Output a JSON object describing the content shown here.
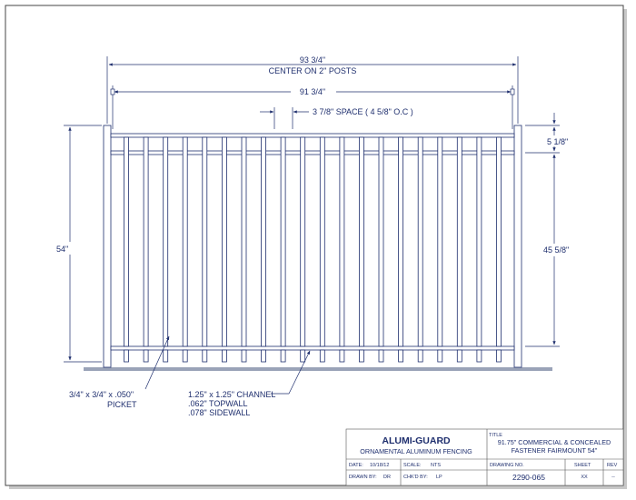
{
  "dimensions": {
    "overall_width": "93 3/4\"",
    "overall_note": "CENTER ON 2\" POSTS",
    "inner_width": "91 3/4\"",
    "picket_space": "3 7/8\" SPACE ( 4 5/8\" O.C )",
    "overall_height": "54\"",
    "top_rail_height": "5 1/8\"",
    "picket_height": "45 5/8\""
  },
  "callouts": {
    "picket_line1": "3/4\" x 3/4\" x  .050\"",
    "picket_line2": "PICKET",
    "channel_line1": "1.25\" x 1.25\" CHANNEL",
    "channel_line2": ".062\" TOPWALL",
    "channel_line3": ".078\" SIDEWALL"
  },
  "title_block": {
    "company": "ALUMI-GUARD",
    "subtitle": "ORNAMENTAL ALUMINUM FENCING",
    "title_label": "TITLE",
    "title_line1": "91.75\" COMMERCIAL & CONCEALED",
    "title_line2": "FASTENER FAIRMOUNT 54\"",
    "date_label": "DATE:",
    "date_value": "10/18/12",
    "scale_label": "SCALE:",
    "scale_value": "NTS",
    "drawing_no_label": "DRAWING NO.",
    "drawing_no_value": "2290-065",
    "sheet_label": "SHEET",
    "sheet_value": "XX",
    "rev_label": "REV",
    "rev_value": "--",
    "drawn_by_label": "DRAWN BY:",
    "drawn_by_value": "DR",
    "chkd_by_label": "CHK'D BY:",
    "chkd_by_value": "LP"
  },
  "colors": {
    "line": "#1f2f6e",
    "frame": "#5a5a7a",
    "ground": "#9aa3b8"
  }
}
